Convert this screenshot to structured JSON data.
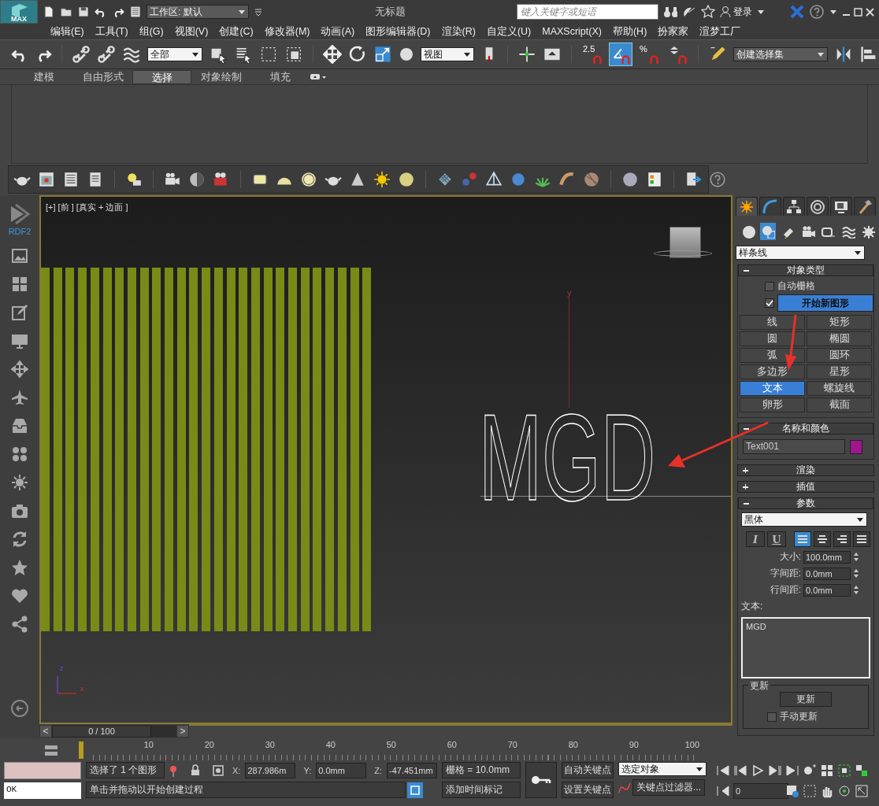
{
  "title_bar": {
    "app_badge": "MAX",
    "workspace": "工作区: 默认",
    "title": "无标题",
    "search": {
      "placeholder": "键入关键字或短语"
    },
    "sign_in": "登录"
  },
  "menu": [
    "编辑(E)",
    "工具(T)",
    "组(G)",
    "视图(V)",
    "创建(C)",
    "修改器(M)",
    "动画(A)",
    "图形编辑器(D)",
    "渲染(R)",
    "自定义(U)",
    "MAXScript(X)",
    "帮助(H)",
    "扮家家",
    "渲梦工厂"
  ],
  "main_toolbar": {
    "selection_filter": "全部",
    "reference_coord": "视图",
    "named_selection": "创建选择集",
    "snaps": [
      {
        "kind": "snap",
        "label": "2.5",
        "on": false
      },
      {
        "kind": "angle",
        "on": true
      },
      {
        "kind": "percent",
        "label": "%",
        "on": false
      },
      {
        "kind": "spinner",
        "on": false
      }
    ]
  },
  "ribbon_tabs": [
    {
      "label": "建模",
      "selected": false
    },
    {
      "label": "自由形式",
      "selected": false
    },
    {
      "label": "选择",
      "selected": true
    },
    {
      "label": "对象绘制",
      "selected": false
    },
    {
      "label": "填充",
      "selected": false
    }
  ],
  "sidebar": {
    "label": "RDF2"
  },
  "viewport": {
    "label": "[+] [前 ] [真实 + 边面 ]",
    "scene_text": "MGD",
    "grid_axis_label": "y",
    "tripod_z": "z",
    "tripod_x": "x"
  },
  "command_panel": {
    "tabs": [
      {
        "selected": true
      },
      {
        "selected": false
      },
      {
        "selected": false
      },
      {
        "selected": false
      },
      {
        "selected": false
      },
      {
        "selected": false
      }
    ],
    "categories": [
      {
        "selected": false
      },
      {
        "selected": true
      },
      {
        "selected": false
      },
      {
        "selected": false
      },
      {
        "selected": false
      },
      {
        "selected": false
      },
      {
        "selected": false
      }
    ],
    "category_dropdown": "样条线",
    "rollouts": [
      {
        "kind": "object_type",
        "title": "对象类型",
        "expanded": true,
        "auto_grid": {
          "label": "自动栅格",
          "checked": false
        },
        "start_new_shape": {
          "label": "开始新图形",
          "checked": true
        },
        "buttons": [
          {
            "label": "线",
            "selected": false
          },
          {
            "label": "矩形",
            "selected": false
          },
          {
            "label": "圆",
            "selected": false
          },
          {
            "label": "椭圆",
            "selected": false
          },
          {
            "label": "弧",
            "selected": false
          },
          {
            "label": "圆环",
            "selected": false
          },
          {
            "label": "多边形",
            "selected": false
          },
          {
            "label": "星形",
            "selected": false
          },
          {
            "label": "文本",
            "selected": true
          },
          {
            "label": "螺旋线",
            "selected": false
          },
          {
            "label": "卵形",
            "selected": false
          },
          {
            "label": "截面",
            "selected": false
          }
        ]
      },
      {
        "kind": "name_color",
        "title": "名称和颜色",
        "expanded": true,
        "name": "Text001",
        "color": "#a0168f"
      },
      {
        "kind": "collapsed",
        "title": "渲染",
        "expanded": false
      },
      {
        "kind": "collapsed",
        "title": "插值",
        "expanded": false
      },
      {
        "kind": "parameters",
        "title": "参数",
        "expanded": true,
        "font": "黑体",
        "styles": [
          {
            "label": "I",
            "on": false
          },
          {
            "label": "U",
            "on": false
          }
        ],
        "alignments": [
          {
            "selected": true
          },
          {
            "selected": false
          },
          {
            "selected": false
          },
          {
            "selected": false
          }
        ],
        "spinners": [
          {
            "label": "大小:",
            "value": "100.0mm"
          },
          {
            "label": "字间距:",
            "value": "0.0mm"
          },
          {
            "label": "行间距:",
            "value": "0.0mm"
          }
        ],
        "text_label": "文本:",
        "text": "MGD",
        "update_group": "更新",
        "update_button": "更新",
        "manual_update": {
          "label": "手动更新",
          "checked": false
        }
      }
    ]
  },
  "time_slider": {
    "prev": "<",
    "position": "0 / 100",
    "level": 0,
    "next": ">"
  },
  "track_bar": {
    "ticks": [
      "10",
      "20",
      "30",
      "40",
      "50",
      "60",
      "70",
      "80",
      "90",
      "100"
    ]
  },
  "status_bar": {
    "listener_ok": "OK",
    "selection": "选择了 1 个图形",
    "coords": [
      {
        "label": "X:",
        "value": "287.986m"
      },
      {
        "label": "Y:",
        "value": "0.0mm"
      },
      {
        "label": "Z:",
        "value": "-47.451mm"
      }
    ],
    "grid": "栅格 = 10.0mm",
    "prompt": "单击并拖动以开始创建过程",
    "add_time_tag": "添加时间标记",
    "auto_key": "自动关键点",
    "set_key": "设置关键点",
    "key_mode": "选定对象",
    "key_filters": "关键点过滤器...",
    "frame": "0"
  }
}
